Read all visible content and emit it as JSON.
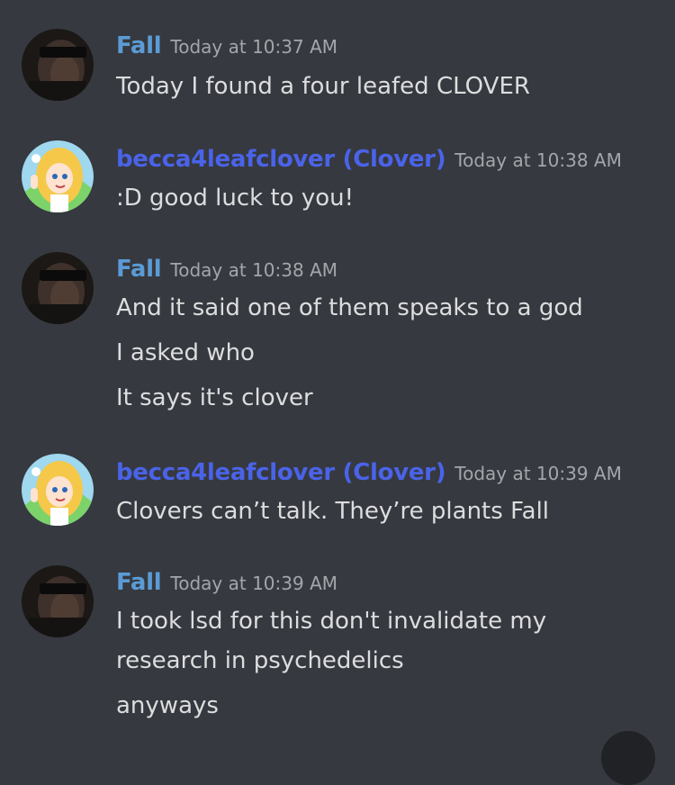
{
  "colors": {
    "background": "#36393f",
    "fall_username": "#5b9bd5",
    "clover_username": "#4a63e8",
    "timestamp": "#a3a6aa",
    "message_text": "#dcddde"
  },
  "messages": [
    {
      "avatar_icon": "sunglasses-man-avatar-icon",
      "username": "Fall",
      "timestamp": "Today at 10:37 AM",
      "lines": [
        "Today I found a four leafed CLOVER"
      ]
    },
    {
      "avatar_icon": "cartoon-girl-avatar-icon",
      "username": "becca4leafclover (Clover)",
      "timestamp": "Today at 10:38 AM",
      "lines": [
        ":D good luck to you!"
      ]
    },
    {
      "avatar_icon": "sunglasses-man-avatar-icon",
      "username": "Fall",
      "timestamp": "Today at 10:38 AM",
      "lines": [
        "And it said one of them speaks to a god",
        "I asked who",
        "It says it's clover"
      ]
    },
    {
      "avatar_icon": "cartoon-girl-avatar-icon",
      "username": "becca4leafclover (Clover)",
      "timestamp": "Today at 10:39 AM",
      "lines": [
        "Clovers can’t talk. They’re plants Fall"
      ]
    },
    {
      "avatar_icon": "sunglasses-man-avatar-icon",
      "username": "Fall",
      "timestamp": "Today at 10:39 AM",
      "lines": [
        "I took lsd for this don't invalidate my",
        "research in psychedelics",
        "anyways"
      ]
    }
  ]
}
